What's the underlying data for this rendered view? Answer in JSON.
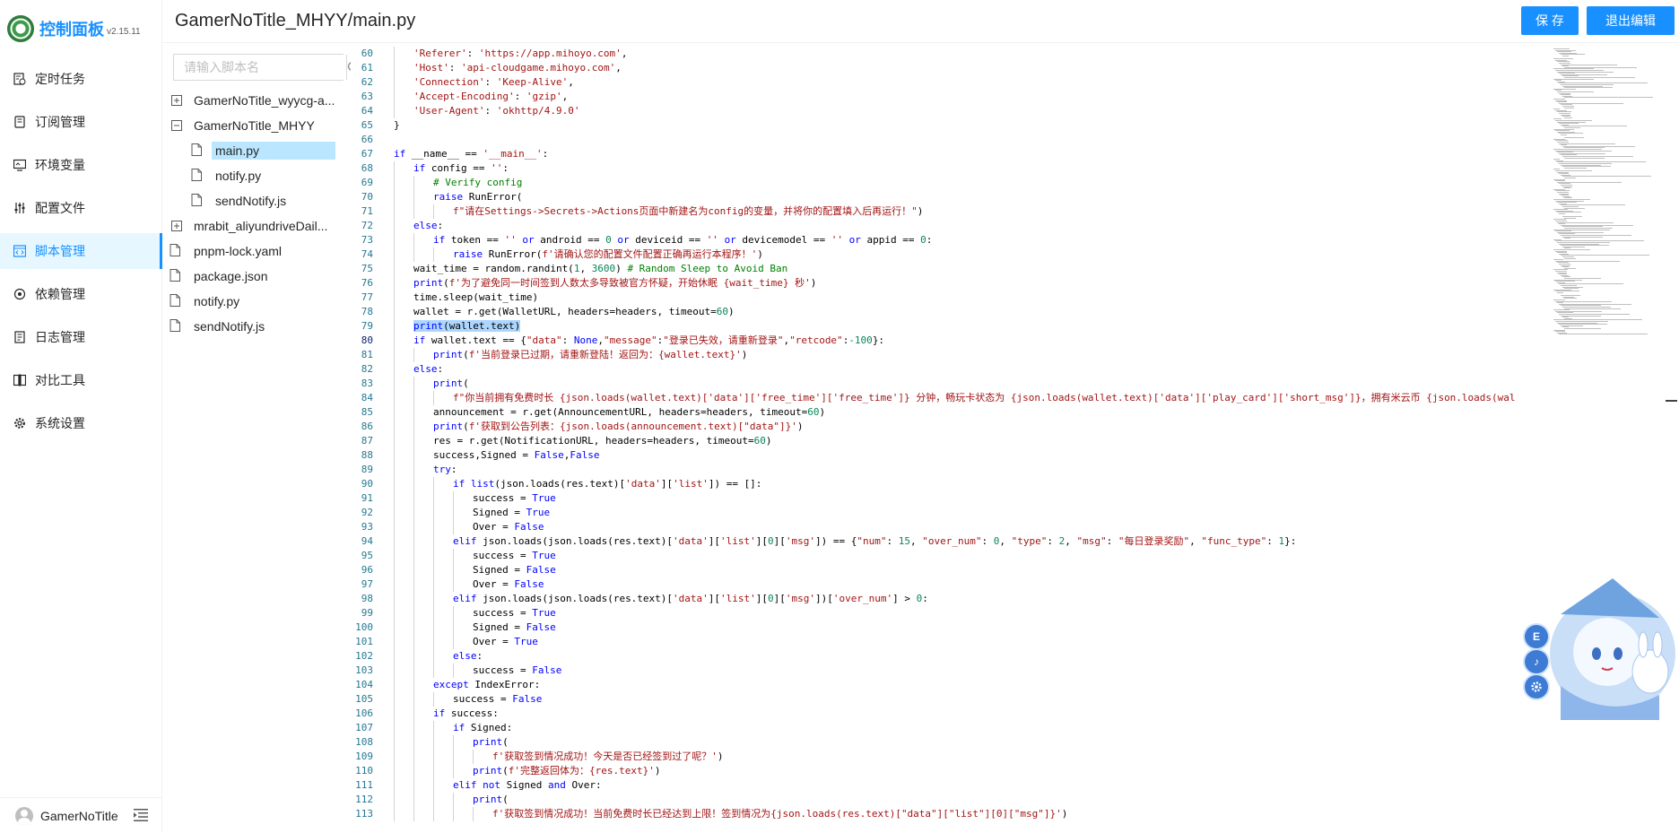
{
  "app": {
    "title": "控制面板",
    "version": "v2.15.11"
  },
  "menu": [
    {
      "label": "定时任务",
      "icon": "clock-list-icon"
    },
    {
      "label": "订阅管理",
      "icon": "subscription-icon"
    },
    {
      "label": "环境变量",
      "icon": "monitor-icon"
    },
    {
      "label": "配置文件",
      "icon": "sliders-icon"
    },
    {
      "label": "脚本管理",
      "icon": "code-box-icon"
    },
    {
      "label": "依赖管理",
      "icon": "dependency-icon"
    },
    {
      "label": "日志管理",
      "icon": "log-icon"
    },
    {
      "label": "对比工具",
      "icon": "diff-icon"
    },
    {
      "label": "系统设置",
      "icon": "gear-icon"
    }
  ],
  "active_menu": "脚本管理",
  "user": {
    "name": "GamerNoTitle"
  },
  "header": {
    "title": "GamerNoTitle_MHYY/main.py",
    "save_label": "保 存",
    "exit_label": "退出编辑"
  },
  "tree": {
    "search_placeholder": "请输入脚本名",
    "nodes": [
      {
        "label": "GamerNoTitle_wyycg-a...",
        "type": "folder",
        "expanded": false,
        "level": 0
      },
      {
        "label": "GamerNoTitle_MHYY",
        "type": "folder",
        "expanded": true,
        "level": 0
      },
      {
        "label": "main.py",
        "type": "file",
        "level": 1,
        "selected": true
      },
      {
        "label": "notify.py",
        "type": "file",
        "level": 1
      },
      {
        "label": "sendNotify.js",
        "type": "file",
        "level": 1
      },
      {
        "label": "mrabit_aliyundriveDail...",
        "type": "folder",
        "expanded": false,
        "level": 0
      },
      {
        "label": "pnpm-lock.yaml",
        "type": "file",
        "level": 0
      },
      {
        "label": "package.json",
        "type": "file",
        "level": 0
      },
      {
        "label": "notify.py",
        "type": "file",
        "level": 0
      },
      {
        "label": "sendNotify.js",
        "type": "file",
        "level": 0
      }
    ]
  },
  "editor": {
    "current_line": 80,
    "lines": [
      {
        "n": "60",
        "indent": 1,
        "code": "'Referer': 'https://app.mihoyo.com',"
      },
      {
        "n": "61",
        "indent": 1,
        "code": "'Host': 'api-cloudgame.mihoyo.com',"
      },
      {
        "n": "62",
        "indent": 1,
        "code": "'Connection': 'Keep-Alive',"
      },
      {
        "n": "63",
        "indent": 1,
        "code": "'Accept-Encoding': 'gzip',"
      },
      {
        "n": "64",
        "indent": 1,
        "code": "'User-Agent': 'okhttp/4.9.0'"
      },
      {
        "n": "65",
        "indent": 0,
        "code": "}"
      },
      {
        "n": "66",
        "indent": 0,
        "code": ""
      },
      {
        "n": "67",
        "indent": 0,
        "code": "if __name__ == '__main__':"
      },
      {
        "n": "68",
        "indent": 1,
        "code": "if config == '':"
      },
      {
        "n": "69",
        "indent": 2,
        "code": "# Verify config"
      },
      {
        "n": "70",
        "indent": 2,
        "code": "raise RunError("
      },
      {
        "n": "71",
        "indent": 3,
        "code": "f\"请在Settings->Secrets->Actions页面中新建名为config的变量，并将你的配置填入后再运行！\")"
      },
      {
        "n": "72",
        "indent": 1,
        "code": "else:"
      },
      {
        "n": "73",
        "indent": 2,
        "code": "if token == '' or android == 0 or deviceid == '' or devicemodel == '' or appid == 0:"
      },
      {
        "n": "74",
        "indent": 3,
        "code": "raise RunError(f'请确认您的配置文件配置正确再运行本程序！')"
      },
      {
        "n": "75",
        "indent": 1,
        "code": "wait_time = random.randint(1, 3600) # Random Sleep to Avoid Ban"
      },
      {
        "n": "76",
        "indent": 1,
        "code": "print(f'为了避免同一时间签到人数太多导致被官方怀疑，开始休眠 {wait_time} 秒')"
      },
      {
        "n": "77",
        "indent": 1,
        "code": "time.sleep(wait_time)"
      },
      {
        "n": "78",
        "indent": 1,
        "code": "wallet = r.get(WalletURL, headers=headers, timeout=60)"
      },
      {
        "n": "79",
        "indent": 1,
        "code": "print(wallet.text)"
      },
      {
        "n": "80",
        "indent": 1,
        "code": "if wallet.text == {\"data\": None,\"message\":\"登录已失效，请重新登录\",\"retcode\":-100}:"
      },
      {
        "n": "81",
        "indent": 2,
        "code": "print(f'当前登录已过期，请重新登陆！返回为：{wallet.text}')"
      },
      {
        "n": "82",
        "indent": 1,
        "code": "else:"
      },
      {
        "n": "83",
        "indent": 2,
        "code": "print("
      },
      {
        "n": "84",
        "indent": 3,
        "code": "f\"你当前拥有免费时长 {json.loads(wallet.text)['data']['free_time']['free_time']} 分钟，畅玩卡状态为 {json.loads(wallet.text)['data']['play_card']['short_msg']}，拥有米云币 {json.loads(wal"
      },
      {
        "n": "85",
        "indent": 2,
        "code": "announcement = r.get(AnnouncementURL, headers=headers, timeout=60)"
      },
      {
        "n": "86",
        "indent": 2,
        "code": "print(f'获取到公告列表：{json.loads(announcement.text)[\"data\"]}')"
      },
      {
        "n": "87",
        "indent": 2,
        "code": "res = r.get(NotificationURL, headers=headers, timeout=60)"
      },
      {
        "n": "88",
        "indent": 2,
        "code": "success,Signed = False,False"
      },
      {
        "n": "89",
        "indent": 2,
        "code": "try:"
      },
      {
        "n": "90",
        "indent": 3,
        "code": "if list(json.loads(res.text)['data']['list']) == []:"
      },
      {
        "n": "91",
        "indent": 4,
        "code": "success = True"
      },
      {
        "n": "92",
        "indent": 4,
        "code": "Signed = True"
      },
      {
        "n": "93",
        "indent": 4,
        "code": "Over = False"
      },
      {
        "n": "94",
        "indent": 3,
        "code": "elif json.loads(json.loads(res.text)['data']['list'][0]['msg']) == {\"num\": 15, \"over_num\": 0, \"type\": 2, \"msg\": \"每日登录奖励\", \"func_type\": 1}:"
      },
      {
        "n": "95",
        "indent": 4,
        "code": "success = True"
      },
      {
        "n": "96",
        "indent": 4,
        "code": "Signed = False"
      },
      {
        "n": "97",
        "indent": 4,
        "code": "Over = False"
      },
      {
        "n": "98",
        "indent": 3,
        "code": "elif json.loads(json.loads(res.text)['data']['list'][0]['msg'])['over_num'] > 0:"
      },
      {
        "n": "99",
        "indent": 4,
        "code": "success = True"
      },
      {
        "n": "100",
        "indent": 4,
        "code": "Signed = False"
      },
      {
        "n": "101",
        "indent": 4,
        "code": "Over = True"
      },
      {
        "n": "102",
        "indent": 3,
        "code": "else:"
      },
      {
        "n": "103",
        "indent": 4,
        "code": "success = False"
      },
      {
        "n": "104",
        "indent": 2,
        "code": "except IndexError:"
      },
      {
        "n": "105",
        "indent": 3,
        "code": "success = False"
      },
      {
        "n": "106",
        "indent": 2,
        "code": "if success:"
      },
      {
        "n": "107",
        "indent": 3,
        "code": "if Signed:"
      },
      {
        "n": "108",
        "indent": 4,
        "code": "print("
      },
      {
        "n": "109",
        "indent": 5,
        "code": "f'获取签到情况成功！今天是否已经签到过了呢？')"
      },
      {
        "n": "110",
        "indent": 4,
        "code": "print(f'完整返回体为：{res.text}')"
      },
      {
        "n": "111",
        "indent": 3,
        "code": "elif not Signed and Over:"
      },
      {
        "n": "112",
        "indent": 4,
        "code": "print("
      },
      {
        "n": "113",
        "indent": 5,
        "code": "f'获取签到情况成功！当前免费时长已经达到上限！签到情况为{json.loads(res.text)[\"data\"][\"list\"][0][\"msg\"]}')"
      }
    ]
  },
  "floating_buttons": [
    "E",
    "♪",
    "gear-icon"
  ]
}
